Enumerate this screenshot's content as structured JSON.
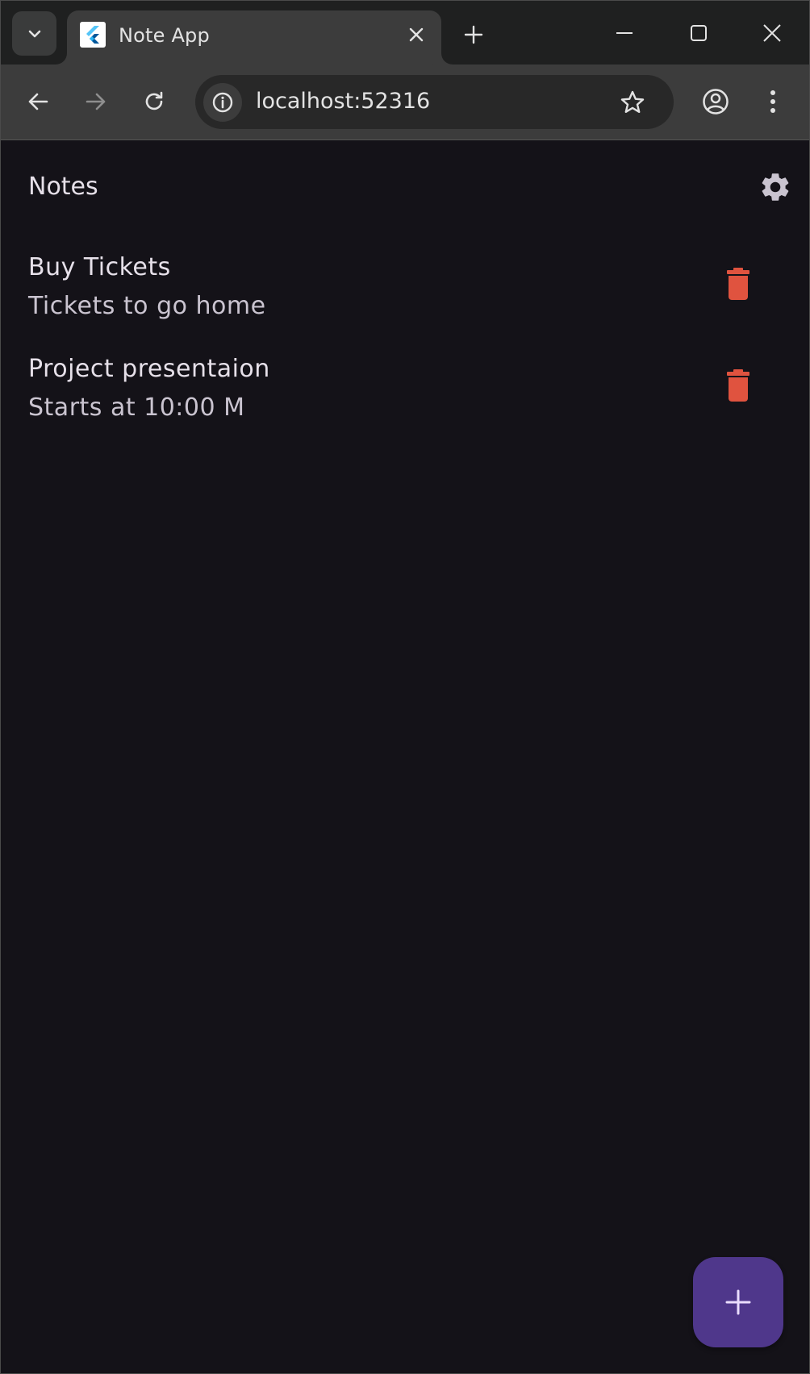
{
  "browser": {
    "tab": {
      "title": "Note App",
      "favicon": "flutter-icon"
    },
    "address_bar": {
      "url": "localhost:52316"
    },
    "icons": {
      "tab_search": "chevron-down-icon",
      "tab_close": "close-icon",
      "new_tab": "plus-icon",
      "minimize": "minimize-icon",
      "maximize": "maximize-icon",
      "close_window": "close-icon",
      "back": "arrow-left-icon",
      "forward": "arrow-right-icon",
      "reload": "reload-icon",
      "site_info": "info-icon",
      "bookmark": "star-icon",
      "profile": "account-icon",
      "menu": "more-vertical-icon"
    }
  },
  "app": {
    "title": "Notes",
    "settings_icon": "gear-icon",
    "notes": [
      {
        "title": "Buy Tickets",
        "body": "Tickets to go home"
      },
      {
        "title": "Project presentaion",
        "body": "Starts at 10:00 M"
      }
    ],
    "delete_icon": "trash-icon",
    "add_icon": "plus-icon"
  },
  "colors": {
    "background": "#141218",
    "delete": "#e0533f",
    "fab": "#4f378b",
    "text_primary": "#e6e0e9",
    "text_secondary": "#cac4d0"
  }
}
